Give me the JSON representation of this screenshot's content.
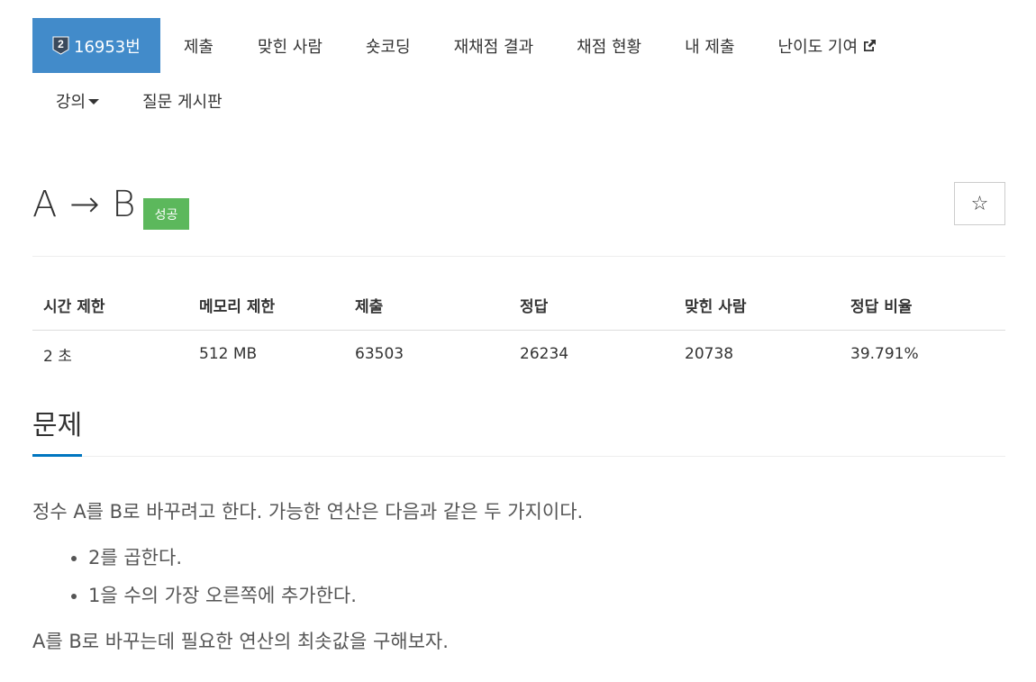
{
  "nav": {
    "active": {
      "tier_num": "2",
      "label": "16953번"
    },
    "items": [
      {
        "label": "제출"
      },
      {
        "label": "맞힌 사람"
      },
      {
        "label": "숏코딩"
      },
      {
        "label": "재채점 결과"
      },
      {
        "label": "채점 현황"
      },
      {
        "label": "내 제출"
      },
      {
        "label": "난이도 기여"
      }
    ],
    "row2": [
      {
        "label": "강의"
      },
      {
        "label": "질문 게시판"
      }
    ],
    "colors": {
      "active_bg": "#428bca",
      "tier_badge": "#3b4a5c"
    },
    "icons": {
      "external": "external-link-icon",
      "caret": "caret-down-icon",
      "tier": "tier-badge-icon"
    }
  },
  "problem": {
    "title": "A → B",
    "result_label": "성공",
    "result_color": "#5cb85c",
    "star_glyph": "☆"
  },
  "info_table": {
    "headers": [
      "시간 제한",
      "메모리 제한",
      "제출",
      "정답",
      "맞힌 사람",
      "정답 비율"
    ],
    "row": [
      "2 초",
      "512 MB",
      "63503",
      "26234",
      "20738",
      "39.791%"
    ]
  },
  "section": {
    "title": "문제",
    "accent": "#0076c0"
  },
  "body": {
    "intro": "정수 A를 B로 바꾸려고 한다. 가능한 연산은 다음과 같은 두 가지이다.",
    "ops": [
      "2를 곱한다.",
      "1을 수의 가장 오른쪽에 추가한다."
    ],
    "outro": "A를 B로 바꾸는데 필요한 연산의 최솟값을 구해보자."
  }
}
